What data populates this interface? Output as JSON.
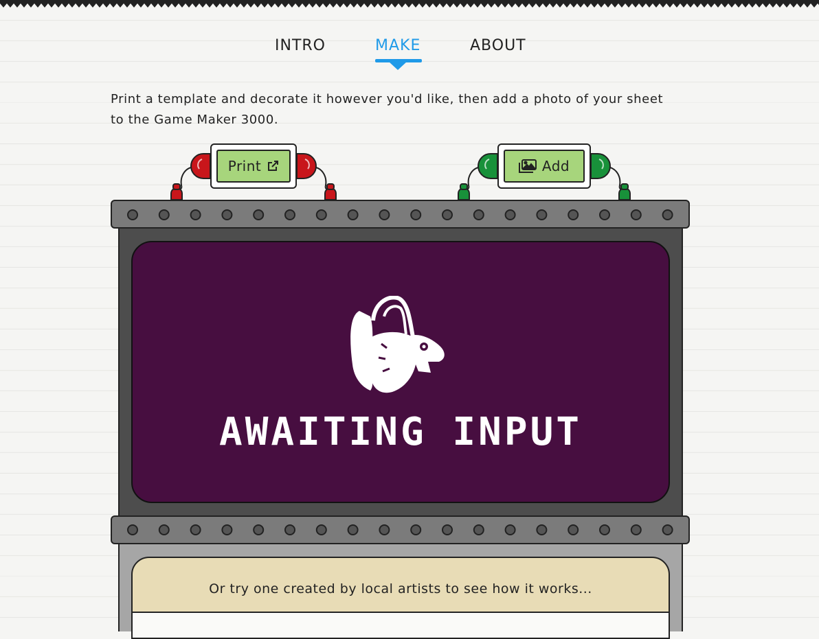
{
  "nav": {
    "items": [
      {
        "label": "INTRO",
        "active": false
      },
      {
        "label": "MAKE",
        "active": true
      },
      {
        "label": "ABOUT",
        "active": false
      }
    ],
    "active_color": "#1f9ae8"
  },
  "intro": {
    "text": "Print a template and decorate it however you'd like, then add a photo of your sheet to the Game Maker 3000."
  },
  "buttons": {
    "print_label": "Print",
    "print_icon": "external-link-icon",
    "add_label": "Add",
    "add_icon": "images-icon"
  },
  "screen": {
    "status_text": "AWAITING INPUT",
    "mascot": "squirrel-icon",
    "background_color": "#470e40"
  },
  "gallery": {
    "prompt": "Or try one created by local artists to see how it works..."
  },
  "colors": {
    "button_green": "#a7d57c",
    "lamp_red": "#c8161b",
    "lamp_green": "#18913a",
    "gallery_bg": "#e8dcb6"
  }
}
